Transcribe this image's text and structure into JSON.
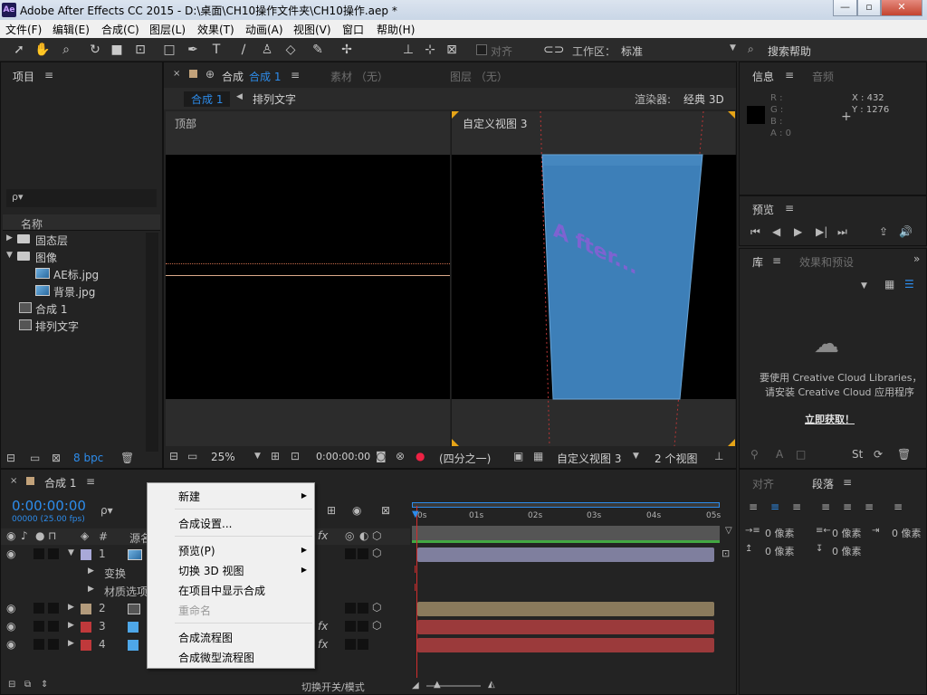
{
  "window": {
    "app_icon": "Ae",
    "title": "Adobe After Effects CC 2015 - D:\\桌面\\CH10操作文件夹\\CH10操作.aep *",
    "min_icon": "minimize-icon",
    "max_icon": "maximize-icon",
    "close_icon": "close-icon"
  },
  "menu": [
    "文件(F)",
    "编辑(E)",
    "合成(C)",
    "图层(L)",
    "效果(T)",
    "动画(A)",
    "视图(V)",
    "窗口",
    "帮助(H)"
  ],
  "toolbar": {
    "align_label": "对齐",
    "workspace_label": "工作区：",
    "workspace_value": "标准",
    "search_help": "搜索帮助"
  },
  "project_panel": {
    "tab": "项目",
    "menu_glyph": "≡",
    "search_placeholder": "ρ▾",
    "column_name": "名称",
    "items": [
      {
        "name": "固态层",
        "type": "folder",
        "expanded": false
      },
      {
        "name": "图像",
        "type": "folder",
        "expanded": true
      },
      {
        "name": "AE标.jpg",
        "type": "image"
      },
      {
        "name": "背景.jpg",
        "type": "image"
      },
      {
        "name": "合成 1",
        "type": "comp"
      },
      {
        "name": "排列文字",
        "type": "comp"
      }
    ],
    "bpc": "8 bpc"
  },
  "comp_panel": {
    "tab_label": "合成",
    "tab_name": "合成 1",
    "footage_tab": "素材 （无）",
    "layer_tab": "图层 （无）",
    "breadcrumb_active": "合成 1",
    "breadcrumb_next": "排列文字",
    "renderer_label": "渲染器:",
    "renderer_value": "经典 3D",
    "view_left": "顶部",
    "view_right": "自定义视图 3",
    "zoom": "25%",
    "timecode": "0:00:00:00",
    "resolution": "(四分之一)",
    "view_select": "自定义视图 3",
    "view_count": "2 个视图",
    "art_text": "A  fter..."
  },
  "info_panel": {
    "tab": "信息",
    "audio_tab": "音频",
    "r": "R :",
    "g": "G :",
    "b": "B :",
    "a": "A : 0",
    "x": "X : 432",
    "y": "Y : 1276"
  },
  "preview_panel": {
    "tab": "预览"
  },
  "library_panel": {
    "tab": "库",
    "effects_tab": "效果和预设",
    "message_line1": "要使用 Creative Cloud Libraries，",
    "message_line2": "请安装 Creative Cloud 应用程序",
    "get_link": "立即获取！"
  },
  "paragraph_panel": {
    "align_tab": "对齐",
    "para_tab": "段落",
    "pixel": "0 像素"
  },
  "timeline": {
    "tab_name": "合成 1",
    "timecode": "0:00:00:00",
    "frame_info": "00000 (25.00 fps)",
    "col_num": "#",
    "col_source": "源名",
    "layers": [
      {
        "num": "1",
        "color": "#a9a9d9",
        "expanded": true
      },
      {
        "num": "2",
        "color": "#b39b7c",
        "expanded": false
      },
      {
        "num": "3",
        "color": "#c0393b",
        "expanded": false
      },
      {
        "num": "4",
        "color": "#c0393b",
        "expanded": false
      }
    ],
    "sub_rows": [
      "变换",
      "材质选项"
    ],
    "ruler": [
      "0s",
      "01s",
      "02s",
      "03s",
      "04s",
      "05s"
    ],
    "switch_mode": "切换开关/模式",
    "fx": "fx"
  },
  "context_menu": {
    "items": [
      {
        "label": "新建",
        "submenu": true,
        "disabled": false
      },
      {
        "label": "合成设置...",
        "submenu": false,
        "disabled": false
      },
      {
        "label": "预览(P)",
        "submenu": true,
        "disabled": false
      },
      {
        "label": "切换 3D 视图",
        "submenu": true,
        "disabled": false
      },
      {
        "label": "在项目中显示合成",
        "submenu": false,
        "disabled": false
      },
      {
        "label": "重命名",
        "submenu": false,
        "disabled": true
      },
      {
        "label": "合成流程图",
        "submenu": false,
        "disabled": false
      },
      {
        "label": "合成微型流程图",
        "submenu": false,
        "disabled": false
      }
    ]
  },
  "colors": {
    "accent": "#2d8ceb",
    "panel_bg": "#232323",
    "viewer_bg": "#000000",
    "plane": "#3d7fb8",
    "playhead": "#d12e2e",
    "track_purple": "#7f7f9e",
    "track_tan": "#8a7a5c",
    "track_red": "#9b3a3b"
  }
}
